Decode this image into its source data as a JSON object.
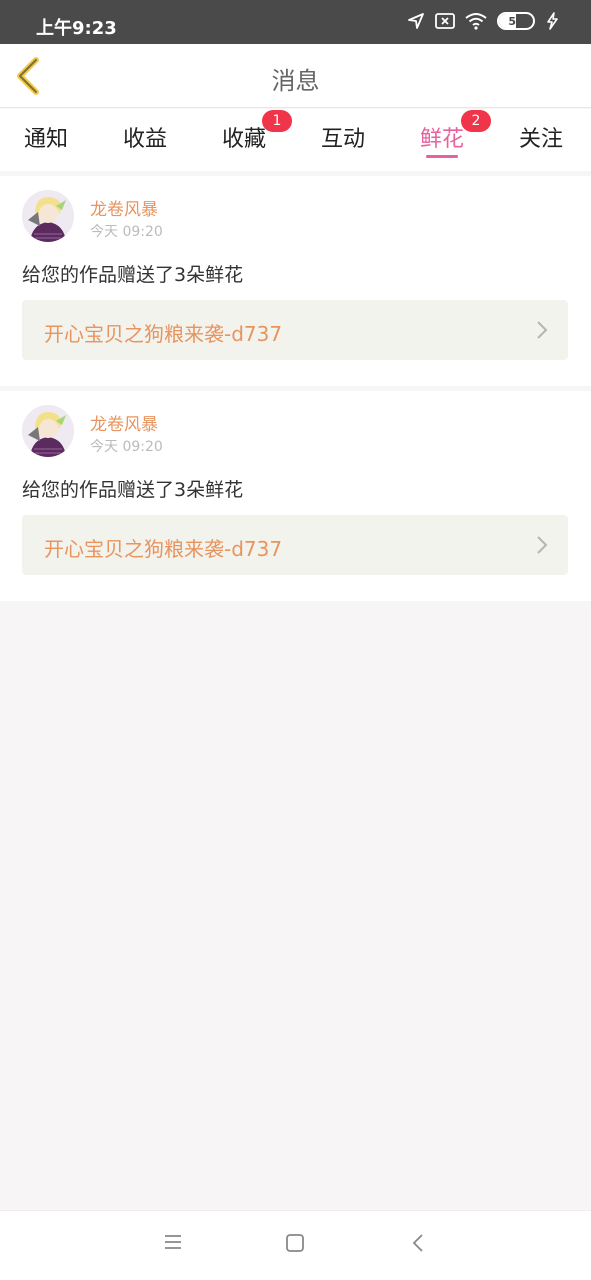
{
  "status_bar": {
    "time": "上午9:23",
    "battery": "50",
    "battery_level": 0.5
  },
  "header": {
    "title": "消息"
  },
  "tabs": [
    {
      "label": "通知",
      "badge": null,
      "active": false
    },
    {
      "label": "收益",
      "badge": null,
      "active": false
    },
    {
      "label": "收藏",
      "badge": "1",
      "active": false
    },
    {
      "label": "互动",
      "badge": null,
      "active": false
    },
    {
      "label": "鲜花",
      "badge": "2",
      "active": true
    },
    {
      "label": "关注",
      "badge": null,
      "active": false
    }
  ],
  "messages": [
    {
      "user": "龙卷风暴",
      "time": "今天 09:20",
      "text": "给您的作品赠送了3朵鲜花",
      "work": "开心宝贝之狗粮来袭-d737"
    },
    {
      "user": "龙卷风暴",
      "time": "今天 09:20",
      "text": "给您的作品赠送了3朵鲜花",
      "work": "开心宝贝之狗粮来袭-d737"
    }
  ],
  "icons": {
    "back": "chevron-left-icon",
    "location": "location-arrow-icon",
    "sim": "no-sim-icon",
    "wifi": "wifi-icon",
    "charging": "charging-icon",
    "menu": "menu-icon",
    "home": "home-icon",
    "nav_back": "nav-back-icon"
  },
  "colors": {
    "accent": "#e8609e",
    "username": "#e8945e",
    "badge": "#f0344a"
  }
}
